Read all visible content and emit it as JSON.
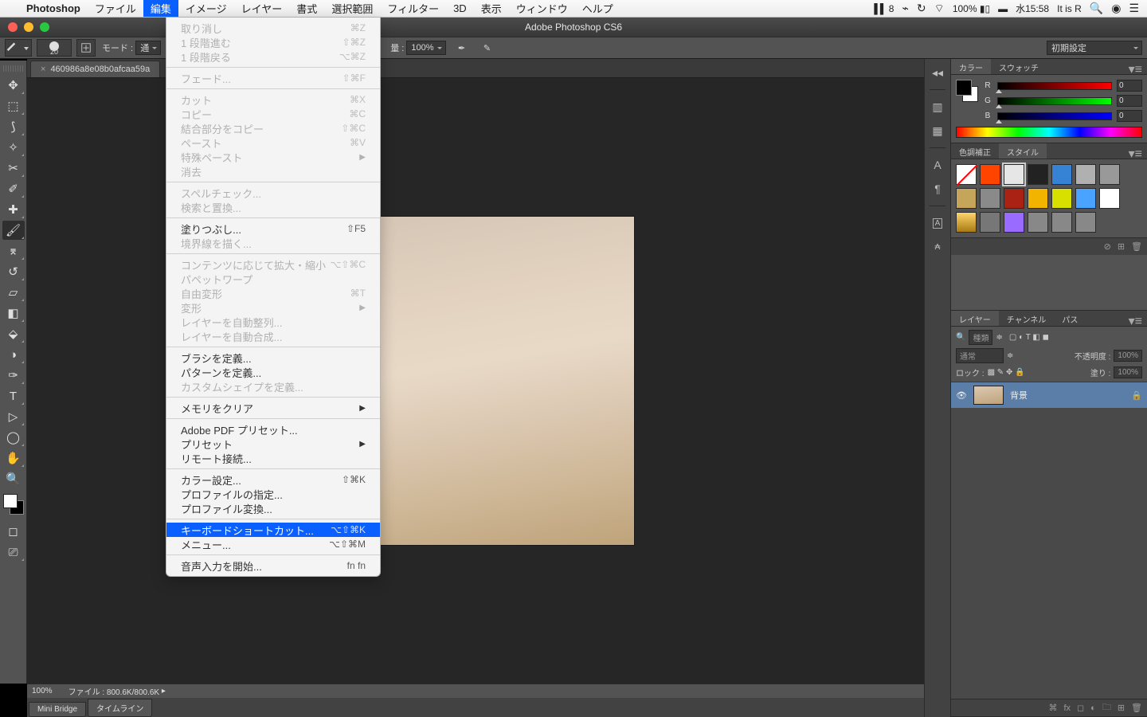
{
  "menubar": {
    "app": "Photoshop",
    "items": [
      "ファイル",
      "編集",
      "イメージ",
      "レイヤー",
      "書式",
      "選択範囲",
      "フィルター",
      "3D",
      "表示",
      "ウィンドウ",
      "ヘルプ"
    ],
    "active_index": 1,
    "right": {
      "adobe": "8",
      "battery": "100%",
      "input": "水",
      "time": "15:58",
      "user": "It is R"
    }
  },
  "dropdown": {
    "sections": [
      [
        {
          "label": "取り消し",
          "shortcut": "⌘Z",
          "state": "disabled"
        },
        {
          "label": "1 段階進む",
          "shortcut": "⇧⌘Z",
          "state": "disabled"
        },
        {
          "label": "1 段階戻る",
          "shortcut": "⌥⌘Z",
          "state": "disabled"
        }
      ],
      [
        {
          "label": "フェード...",
          "shortcut": "⇧⌘F",
          "state": "disabled"
        }
      ],
      [
        {
          "label": "カット",
          "shortcut": "⌘X",
          "state": "disabled"
        },
        {
          "label": "コピー",
          "shortcut": "⌘C",
          "state": "disabled"
        },
        {
          "label": "結合部分をコピー",
          "shortcut": "⇧⌘C",
          "state": "disabled"
        },
        {
          "label": "ペースト",
          "shortcut": "⌘V",
          "state": "disabled"
        },
        {
          "label": "特殊ペースト",
          "submenu": true,
          "state": "disabled"
        },
        {
          "label": "消去",
          "state": "disabled"
        }
      ],
      [
        {
          "label": "スペルチェック...",
          "state": "disabled"
        },
        {
          "label": "検索と置換...",
          "state": "disabled"
        }
      ],
      [
        {
          "label": "塗りつぶし...",
          "shortcut": "⇧F5",
          "state": "enabled"
        },
        {
          "label": "境界線を描く...",
          "state": "disabled"
        }
      ],
      [
        {
          "label": "コンテンツに応じて拡大・縮小",
          "shortcut": "⌥⇧⌘C",
          "state": "disabled"
        },
        {
          "label": "パペットワープ",
          "state": "disabled"
        },
        {
          "label": "自由変形",
          "shortcut": "⌘T",
          "state": "disabled"
        },
        {
          "label": "変形",
          "submenu": true,
          "state": "disabled"
        },
        {
          "label": "レイヤーを自動整列...",
          "state": "disabled"
        },
        {
          "label": "レイヤーを自動合成...",
          "state": "disabled"
        }
      ],
      [
        {
          "label": "ブラシを定義...",
          "state": "enabled"
        },
        {
          "label": "パターンを定義...",
          "state": "enabled"
        },
        {
          "label": "カスタムシェイプを定義...",
          "state": "disabled"
        }
      ],
      [
        {
          "label": "メモリをクリア",
          "submenu": true,
          "state": "enabled"
        }
      ],
      [
        {
          "label": "Adobe PDF プリセット...",
          "state": "enabled"
        },
        {
          "label": "プリセット",
          "submenu": true,
          "state": "enabled"
        },
        {
          "label": "リモート接続...",
          "state": "enabled"
        }
      ],
      [
        {
          "label": "カラー設定...",
          "shortcut": "⇧⌘K",
          "state": "enabled"
        },
        {
          "label": "プロファイルの指定...",
          "state": "enabled"
        },
        {
          "label": "プロファイル変換...",
          "state": "enabled"
        }
      ],
      [
        {
          "label": "キーボードショートカット...",
          "shortcut": "⌥⇧⌘K",
          "state": "highlight"
        },
        {
          "label": "メニュー...",
          "shortcut": "⌥⇧⌘M",
          "state": "enabled"
        }
      ],
      [
        {
          "label": "音声入力を開始...",
          "shortcut": "fn fn",
          "state": "enabled"
        }
      ]
    ]
  },
  "window": {
    "title": "Adobe Photoshop CS6"
  },
  "options": {
    "brush_size": "20",
    "mode_label": "モード :",
    "mode_value": "通",
    "flow_label": "量 :",
    "flow_value": "100%",
    "preset": "初期設定"
  },
  "doc_tab": {
    "name": "460986a8e08b0afcaa59a"
  },
  "status": {
    "zoom": "100%",
    "file_info": "ファイル : 800.6K/800.6K"
  },
  "bottom_tabs": [
    "Mini Bridge",
    "タイムライン"
  ],
  "color_panel": {
    "tabs": [
      "カラー",
      "スウォッチ"
    ],
    "r": "0",
    "g": "0",
    "b": "0"
  },
  "adjust_panel": {
    "tabs": [
      "色調補正",
      "スタイル"
    ]
  },
  "styles": [
    "#ffffff00",
    "#ff4400",
    "#e6e6e6",
    "#222222",
    "#3682d4",
    "#b0b0b0",
    "#999999",
    "#c4a55a",
    "#8a8a8a",
    "#aa2214",
    "#f3b400",
    "#d8e000",
    "#4aa3ff",
    "#ffffff",
    "linear-gradient(#ffd36b,#a87a12)",
    "#777",
    "#9a6bff",
    "#888",
    "#888",
    "#888"
  ],
  "layers_panel": {
    "tabs": [
      "レイヤー",
      "チャンネル",
      "パス"
    ],
    "kind_label": "種類",
    "blend": "通常",
    "opacity_label": "不透明度 :",
    "opacity": "100%",
    "lock_label": "ロック :",
    "fill_label": "塗り :",
    "fill": "100%",
    "layer_name": "背景"
  }
}
